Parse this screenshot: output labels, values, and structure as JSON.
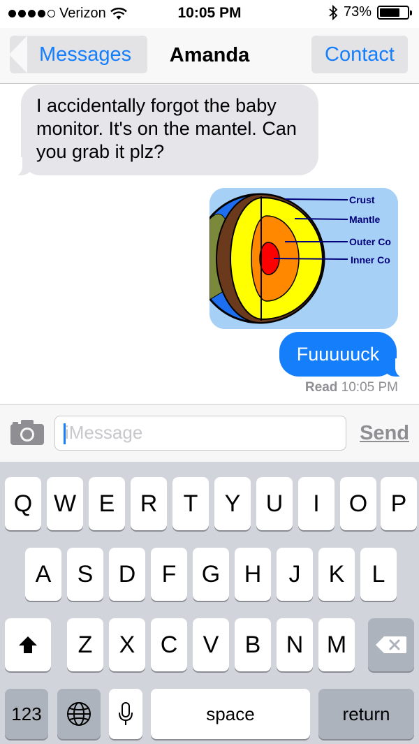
{
  "status_bar": {
    "carrier": "Verizon",
    "time": "10:05 PM",
    "battery": "73%",
    "battery_level": 0.73
  },
  "nav": {
    "back_label": "Messages",
    "title": "Amanda",
    "contact_label": "Contact"
  },
  "messages": {
    "incoming_text": "I accidentally forgot the baby monitor. It's on the mantel. Can you grab it plz?",
    "outgoing_text": "Fuuuuuck",
    "read_label": "Read",
    "read_time": "10:05 PM"
  },
  "image": {
    "labels": [
      "Crust",
      "Mantle",
      "Outer Co",
      "Inner Co"
    ]
  },
  "input": {
    "placeholder": "iMessage",
    "send_label": "Send"
  },
  "keyboard": {
    "row1": [
      "Q",
      "W",
      "E",
      "R",
      "T",
      "Y",
      "U",
      "I",
      "O",
      "P"
    ],
    "row2": [
      "A",
      "S",
      "D",
      "F",
      "G",
      "H",
      "J",
      "K",
      "L"
    ],
    "row3": [
      "Z",
      "X",
      "C",
      "V",
      "B",
      "N",
      "M"
    ],
    "numbers_label": "123",
    "space_label": "space",
    "return_label": "return"
  },
  "colors": {
    "accent": "#157efb",
    "incoming_bubble": "#e5e5ea",
    "keyboard_bg": "#d1d5db"
  }
}
